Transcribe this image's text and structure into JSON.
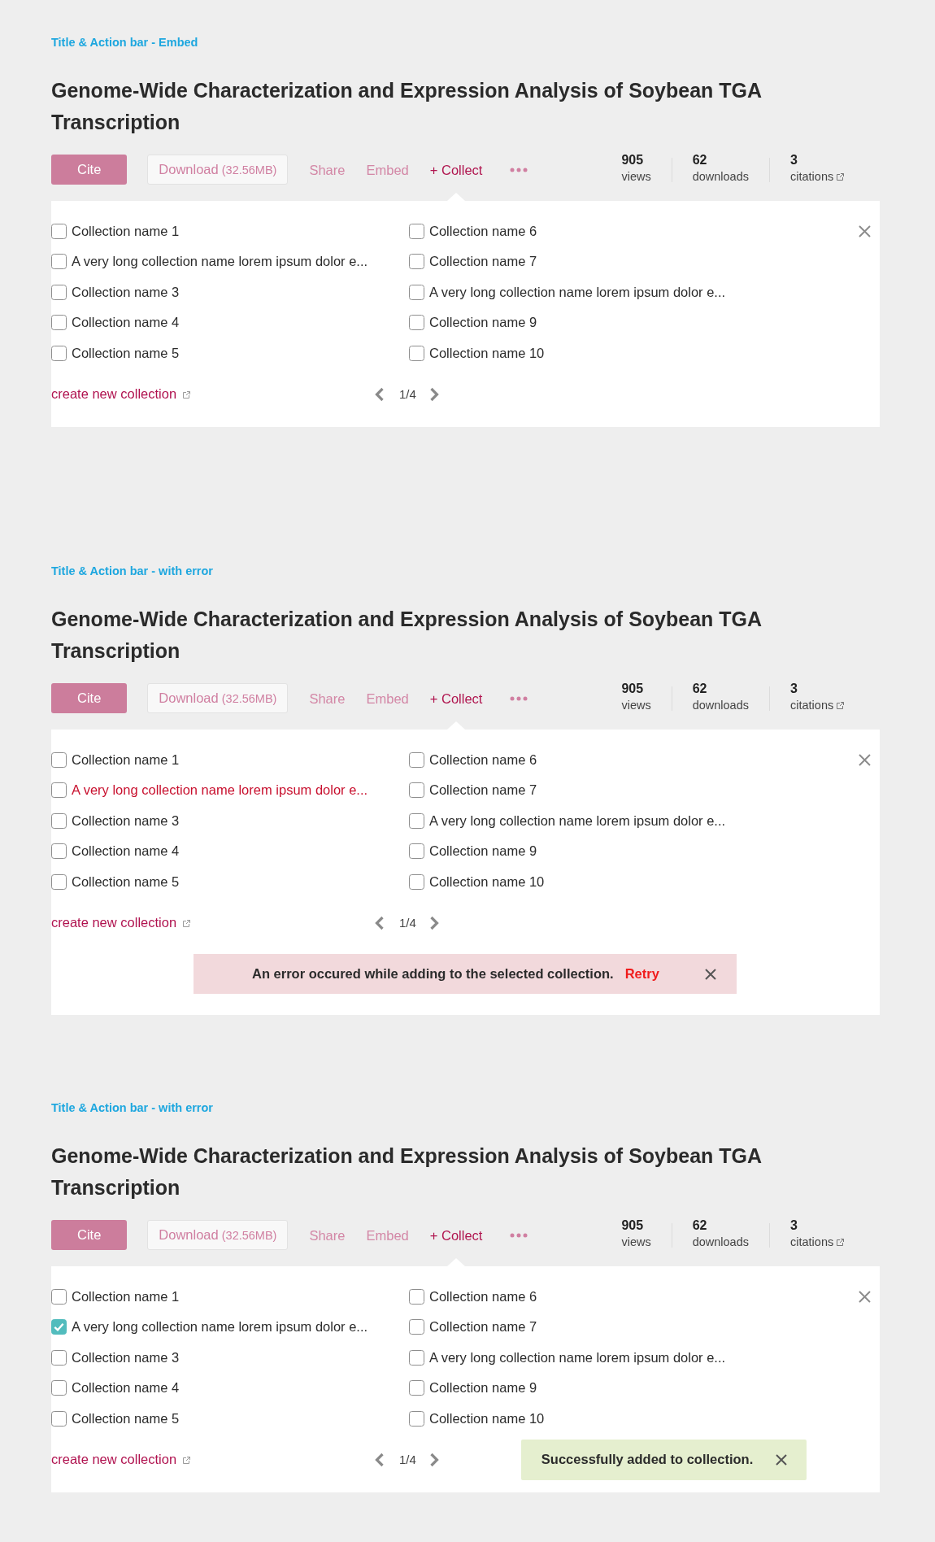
{
  "sections": [
    {
      "heading": "Title & Action bar - Embed",
      "title": "Genome-Wide Characterization and Expression Analysis of Soybean TGA Transcription",
      "actions": [
        {
          "kind": "primary",
          "label": "Cite"
        },
        {
          "kind": "download",
          "label": "Download",
          "size": "(32.56MB)"
        },
        {
          "kind": "link",
          "label": "Share",
          "selected": false
        },
        {
          "kind": "link",
          "label": "Embed",
          "selected": false
        },
        {
          "kind": "link",
          "label": "+ Collect",
          "selected": true
        },
        {
          "kind": "more"
        }
      ],
      "stats": [
        {
          "value": "905",
          "label": "views",
          "external": false
        },
        {
          "value": "62",
          "label": "downloads",
          "external": false
        },
        {
          "value": "3",
          "label": "citations",
          "external": true
        }
      ],
      "collections": [
        {
          "label": "Collection name 1",
          "checked": false,
          "error": false
        },
        {
          "label": "A very long collection name lorem ipsum dolor e...",
          "checked": false,
          "error": false
        },
        {
          "label": "Collection name 3",
          "checked": false,
          "error": false
        },
        {
          "label": "Collection name 4",
          "checked": false,
          "error": false
        },
        {
          "label": "Collection name 5",
          "checked": false,
          "error": false
        },
        {
          "label": "Collection name 6",
          "checked": false,
          "error": false
        },
        {
          "label": "Collection name 7",
          "checked": false,
          "error": false
        },
        {
          "label": "A very long collection name lorem ipsum dolor e...",
          "checked": false,
          "error": false
        },
        {
          "label": "Collection name 9",
          "checked": false,
          "error": false
        },
        {
          "label": "Collection name 10",
          "checked": false,
          "error": false
        }
      ],
      "create_link": "create new collection",
      "pagination": "1/4"
    },
    {
      "heading": "Title & Action bar - with error",
      "title": "Genome-Wide Characterization and Expression Analysis of Soybean TGA Transcription",
      "actions": [
        {
          "kind": "primary",
          "label": "Cite"
        },
        {
          "kind": "download",
          "label": "Download",
          "size": "(32.56MB)"
        },
        {
          "kind": "link",
          "label": "Share",
          "selected": false
        },
        {
          "kind": "link",
          "label": "Embed",
          "selected": false
        },
        {
          "kind": "link",
          "label": "+ Collect",
          "selected": true
        },
        {
          "kind": "more"
        }
      ],
      "stats": [
        {
          "value": "905",
          "label": "views",
          "external": false
        },
        {
          "value": "62",
          "label": "downloads",
          "external": false
        },
        {
          "value": "3",
          "label": "citations",
          "external": true
        }
      ],
      "collections": [
        {
          "label": "Collection name 1",
          "checked": false,
          "error": false
        },
        {
          "label": "A very long collection name lorem ipsum dolor e...",
          "checked": false,
          "error": true
        },
        {
          "label": "Collection name 3",
          "checked": false,
          "error": false
        },
        {
          "label": "Collection name 4",
          "checked": false,
          "error": false
        },
        {
          "label": "Collection name 5",
          "checked": false,
          "error": false
        },
        {
          "label": "Collection name 6",
          "checked": false,
          "error": false
        },
        {
          "label": "Collection name 7",
          "checked": false,
          "error": false
        },
        {
          "label": "A very long collection name lorem ipsum dolor e...",
          "checked": false,
          "error": false
        },
        {
          "label": "Collection name 9",
          "checked": false,
          "error": false
        },
        {
          "label": "Collection name 10",
          "checked": false,
          "error": false
        }
      ],
      "create_link": "create new collection",
      "pagination": "1/4",
      "notice": {
        "kind": "error",
        "message": "An error occured while adding to the selected collection.",
        "action": "Retry"
      }
    },
    {
      "heading": "Title & Action bar - with error",
      "title": "Genome-Wide Characterization and Expression Analysis of Soybean TGA Transcription",
      "actions": [
        {
          "kind": "primary",
          "label": "Cite"
        },
        {
          "kind": "download",
          "label": "Download",
          "size": "(32.56MB)"
        },
        {
          "kind": "link",
          "label": "Share",
          "selected": false
        },
        {
          "kind": "link",
          "label": "Embed",
          "selected": false
        },
        {
          "kind": "link",
          "label": "+ Collect",
          "selected": true
        },
        {
          "kind": "more"
        }
      ],
      "stats": [
        {
          "value": "905",
          "label": "views",
          "external": false
        },
        {
          "value": "62",
          "label": "downloads",
          "external": false
        },
        {
          "value": "3",
          "label": "citations",
          "external": true
        }
      ],
      "collections": [
        {
          "label": "Collection name 1",
          "checked": false,
          "error": false
        },
        {
          "label": "A very long collection name lorem ipsum dolor e...",
          "checked": true,
          "error": false
        },
        {
          "label": "Collection name 3",
          "checked": false,
          "error": false
        },
        {
          "label": "Collection name 4",
          "checked": false,
          "error": false
        },
        {
          "label": "Collection name 5",
          "checked": false,
          "error": false
        },
        {
          "label": "Collection name 6",
          "checked": false,
          "error": false
        },
        {
          "label": "Collection name 7",
          "checked": false,
          "error": false
        },
        {
          "label": "A very long collection name lorem ipsum dolor e...",
          "checked": false,
          "error": false
        },
        {
          "label": "Collection name 9",
          "checked": false,
          "error": false
        },
        {
          "label": "Collection name 10",
          "checked": false,
          "error": false
        }
      ],
      "create_link": "create new collection",
      "pagination": "1/4",
      "notice": {
        "kind": "success",
        "message": "Successfully added to collection."
      }
    }
  ]
}
